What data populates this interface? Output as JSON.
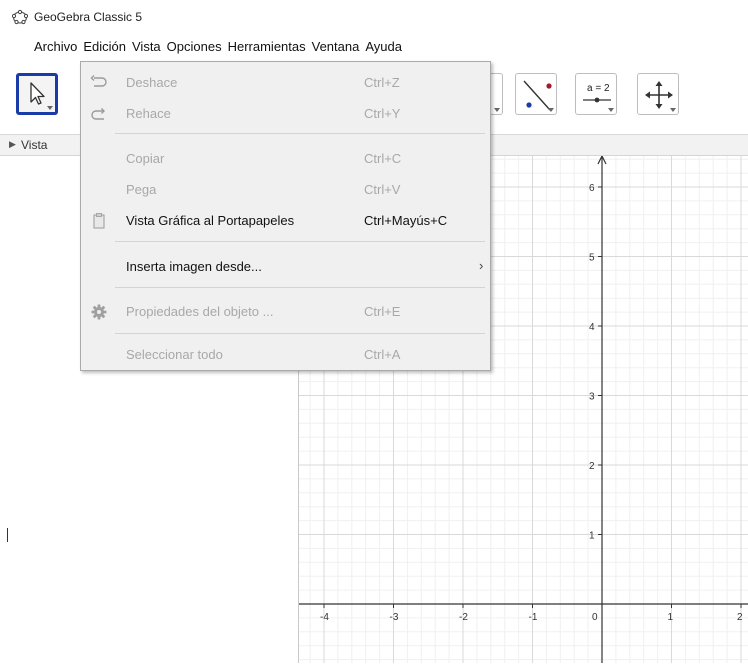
{
  "window": {
    "title": "GeoGebra Classic 5"
  },
  "menubar": [
    "Archivo",
    "Edición",
    "Vista",
    "Opciones",
    "Herramientas",
    "Ventana",
    "Ayuda"
  ],
  "toolbar": {
    "tools": [
      {
        "name": "move-tool",
        "selected": true
      },
      {
        "name": "line-tool"
      },
      {
        "name": "perpendicular-tool"
      },
      {
        "name": "slope-tool"
      },
      {
        "name": "slider-tool",
        "label": "a = 2"
      },
      {
        "name": "move-graphics-view-tool"
      }
    ]
  },
  "vista_header": "Vista",
  "edit_menu": {
    "items": [
      {
        "label": "Deshace",
        "shortcut": "Ctrl+Z",
        "enabled": false,
        "icon": "undo-icon"
      },
      {
        "label": "Rehace",
        "shortcut": "Ctrl+Y",
        "enabled": false,
        "icon": "redo-icon"
      },
      {
        "label": "Copiar",
        "shortcut": "Ctrl+C",
        "enabled": false
      },
      {
        "label": "Pega",
        "shortcut": "Ctrl+V",
        "enabled": false
      },
      {
        "label": "Vista Gráfica al Portapapeles",
        "shortcut": "Ctrl+Mayús+C",
        "enabled": true,
        "icon": "clipboard-icon"
      },
      {
        "label": "Inserta imagen desde...",
        "shortcut": "",
        "enabled": true,
        "submenu": true
      },
      {
        "label": "Propiedades del objeto ...",
        "shortcut": "Ctrl+E",
        "enabled": false,
        "icon": "gear-icon"
      },
      {
        "label": "Seleccionar todo",
        "shortcut": "Ctrl+A",
        "enabled": false
      }
    ]
  },
  "graphics": {
    "x_ticks": [
      "-4",
      "-3",
      "-2",
      "-1",
      "0",
      "1",
      "2"
    ],
    "y_ticks": [
      "6",
      "5",
      "4",
      "3",
      "2",
      "1"
    ]
  },
  "colors": {
    "selected_border": "#1a3ca8",
    "menu_bg": "#f0f0f0",
    "disabled_text": "#a8a8a8",
    "grid": "#e6e6e6"
  }
}
